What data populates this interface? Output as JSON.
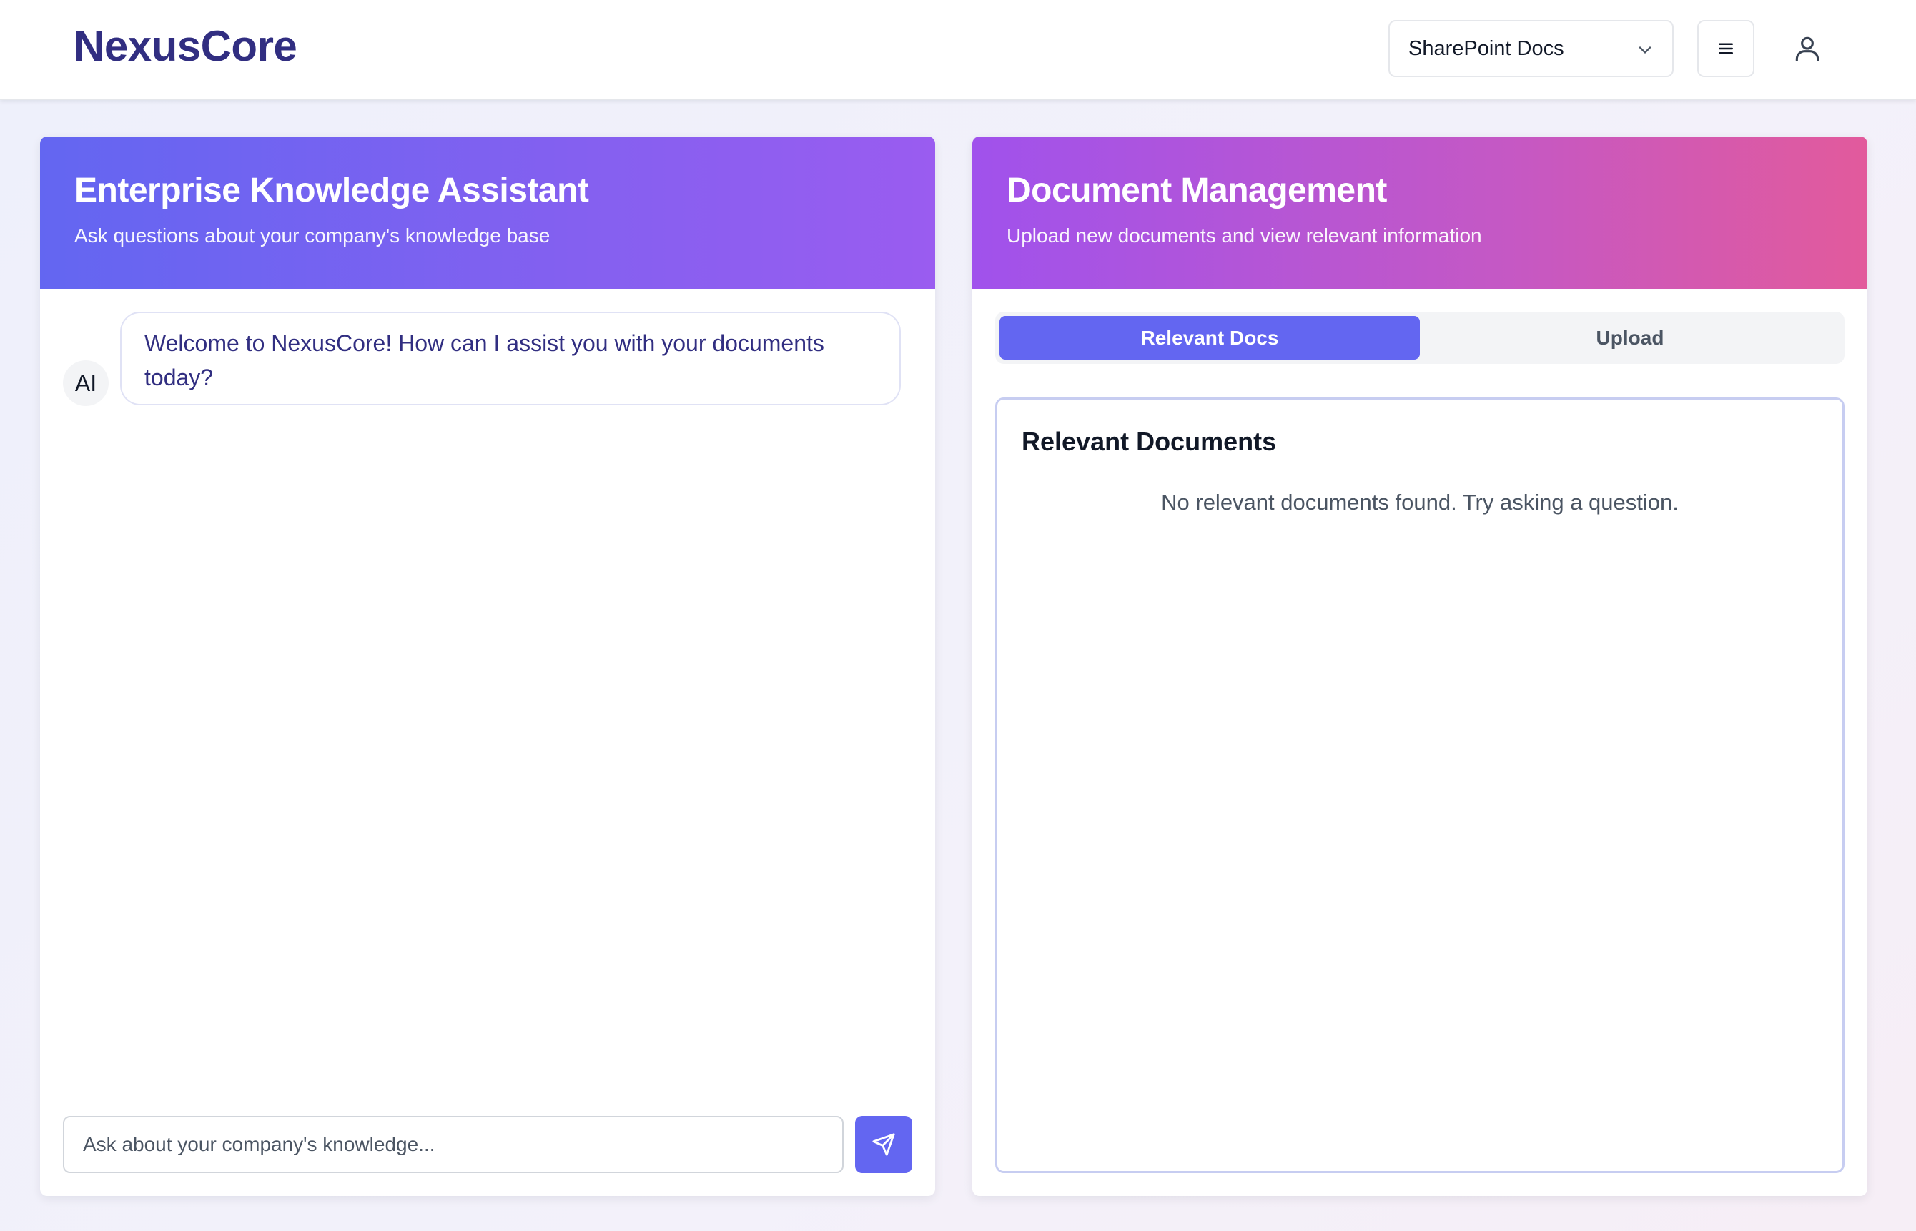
{
  "header": {
    "brand": "NexusCore",
    "source_select": {
      "selected": "SharePoint Docs"
    }
  },
  "chat_panel": {
    "title": "Enterprise Knowledge Assistant",
    "subtitle": "Ask questions about your company's knowledge base",
    "messages": [
      {
        "sender": "AI",
        "text": "Welcome to NexusCore! How can I assist you with your documents today?"
      }
    ],
    "input": {
      "placeholder": "Ask about your company's knowledge...",
      "value": ""
    }
  },
  "docs_panel": {
    "title": "Document Management",
    "subtitle": "Upload new documents and view relevant information",
    "tabs": [
      {
        "label": "Relevant Docs",
        "active": true
      },
      {
        "label": "Upload",
        "active": false
      }
    ],
    "section_title": "Relevant Documents",
    "empty_text": "No relevant documents found. Try asking a question."
  },
  "colors": {
    "brand": "#312e81",
    "accent": "#6366f1",
    "gradient_left": [
      "#6366f1",
      "#9a5cf0"
    ],
    "gradient_right": [
      "#a052ec",
      "#e25a9c"
    ]
  },
  "icons": [
    "chevron-down-icon",
    "menu-icon",
    "user-icon",
    "send-icon"
  ]
}
